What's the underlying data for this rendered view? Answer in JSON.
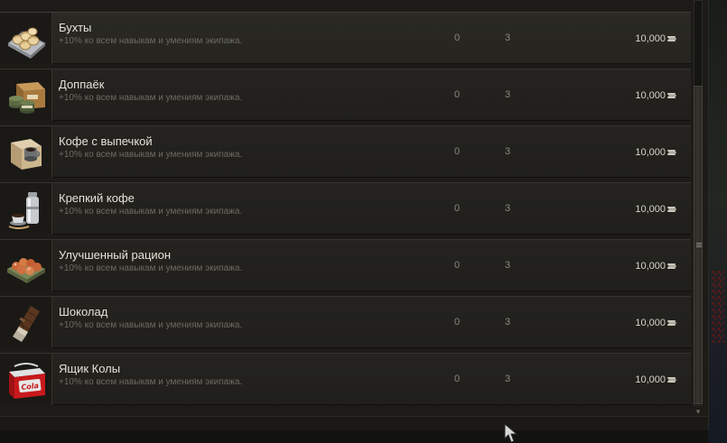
{
  "items": [
    {
      "name": "Бухты",
      "description": "+10% ко всем навыкам и умениям экипажа.",
      "count_a": "0",
      "count_b": "3",
      "price": "10,000",
      "icon": "rolls-tray-icon",
      "selected": true
    },
    {
      "name": "Доппаёк",
      "description": "+10% ко всем навыкам и умениям экипажа.",
      "count_a": "0",
      "count_b": "3",
      "price": "10,000",
      "icon": "ration-box-icon"
    },
    {
      "name": "Кофе с выпечкой",
      "description": "+10% ко всем навыкам и умениям экипажа.",
      "count_a": "0",
      "count_b": "3",
      "price": "10,000",
      "icon": "coffee-box-icon"
    },
    {
      "name": "Крепкий кофе",
      "description": "+10% ко всем навыкам и умениям экипажа.",
      "count_a": "0",
      "count_b": "3",
      "price": "10,000",
      "icon": "thermos-icon"
    },
    {
      "name": "Улучшенный рацион",
      "description": "+10% ко всем навыкам и умениям экипажа.",
      "count_a": "0",
      "count_b": "3",
      "price": "10,000",
      "icon": "food-tin-icon"
    },
    {
      "name": "Шоколад",
      "description": "+10% ко всем навыкам и умениям экипажа.",
      "count_a": "0",
      "count_b": "3",
      "price": "10,000",
      "icon": "chocolate-bar-icon"
    },
    {
      "name": "Ящик Колы",
      "description": "+10% ко всем навыкам и умениям экипажа.",
      "count_a": "0",
      "count_b": "3",
      "price": "10,000",
      "icon": "cola-cooler-icon",
      "icon_text": "Cola"
    }
  ],
  "currency_icon": "credits-icon",
  "colors": {
    "panel": "#1c1b18",
    "row": "#23221e",
    "text": "#e4e2d8",
    "muted": "#6b6a61",
    "cola_red": "#c8191c"
  }
}
